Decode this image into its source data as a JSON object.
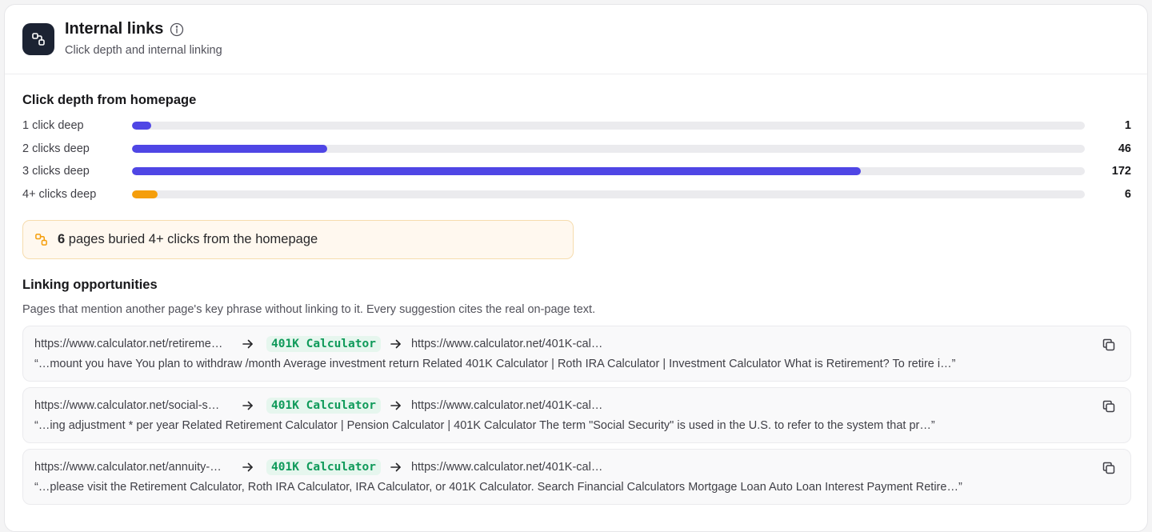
{
  "header": {
    "title": "Internal links",
    "subtitle": "Click depth and internal linking",
    "icon": "link-nodes-icon",
    "info_icon": "info-icon"
  },
  "click_depth": {
    "title": "Click depth from homepage",
    "max_value": 220,
    "rows": [
      {
        "label": "1 click deep",
        "value": "1",
        "fraction": 0.02,
        "color": "#4f46e5"
      },
      {
        "label": "2 clicks deep",
        "value": "46",
        "fraction": 0.205,
        "color": "#4f46e5"
      },
      {
        "label": "3 clicks deep",
        "value": "172",
        "fraction": 0.765,
        "color": "#4f46e5"
      },
      {
        "label": "4+ clicks deep",
        "value": "6",
        "fraction": 0.027,
        "color": "#f59e0b"
      }
    ]
  },
  "alert": {
    "count": "6",
    "text": "pages buried 4+ clicks from the homepage",
    "icon": "link-nodes-icon",
    "color": "#f59e0b"
  },
  "linking": {
    "title": "Linking opportunities",
    "description": "Pages that mention another page's key phrase without linking to it. Every suggestion cites the real on-page text.",
    "items": [
      {
        "source": "https://www.calculator.net/retireme…",
        "phrase": "401K Calculator",
        "target": "https://www.calculator.net/401K-cal…",
        "quote": "“…mount you have You plan to withdraw /month Average investment return Related 401K Calculator | Roth IRA Calculator | Investment Calculator What is Retirement? To retire i…”"
      },
      {
        "source": "https://www.calculator.net/social-s…",
        "phrase": "401K Calculator",
        "target": "https://www.calculator.net/401K-cal…",
        "quote": "“…ing adjustment * per year Related Retirement Calculator | Pension Calculator | 401K Calculator The term \"Social Security\" is used in the U.S. to refer to the system that pr…”"
      },
      {
        "source": "https://www.calculator.net/annuity-…",
        "phrase": "401K Calculator",
        "target": "https://www.calculator.net/401K-cal…",
        "quote": "“…please visit the Retirement Calculator, Roth IRA Calculator, IRA Calculator, or 401K Calculator. Search Financial Calculators Mortgage Loan Auto Loan Interest Payment Retire…”"
      }
    ]
  },
  "colors": {
    "accent": "#4f46e5",
    "warning": "#f59e0b",
    "phrase": "#0f9a5a"
  }
}
